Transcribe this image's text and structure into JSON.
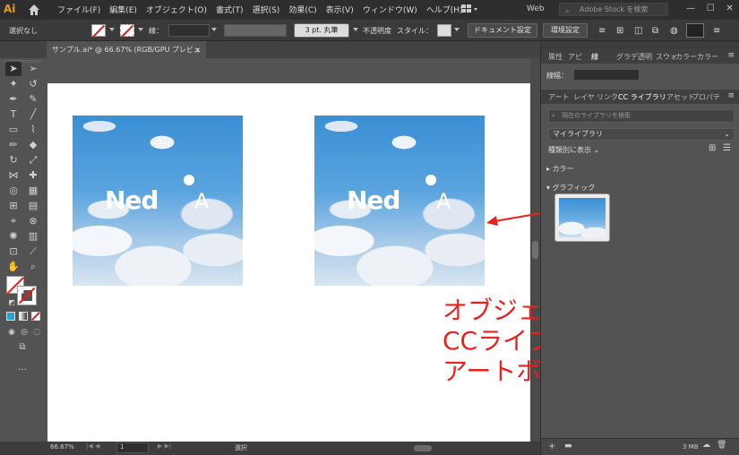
{
  "app": {
    "logo": "Ai"
  },
  "menubar": {
    "items": [
      "ファイル(F)",
      "編集(E)",
      "オブジェクト(O)",
      "書式(T)",
      "選択(S)",
      "効果(C)",
      "表示(V)",
      "ウィンドウ(W)",
      "ヘルプ(H)"
    ],
    "workspace": "Web",
    "stock_placeholder": "Adobe Stock を検索"
  },
  "control": {
    "selection": "選択なし",
    "stroke_label": "線：",
    "brush": "3 pt. 丸筆",
    "opacity_label": "不透明度",
    "style_label": "スタイル：",
    "doc_settings": "ドキュメント設定",
    "env_settings": "環境設定"
  },
  "document": {
    "tab_title": "サンプル.ai* @ 66.67% (RGB/GPU プレビュー)",
    "close": "×"
  },
  "canvas": {
    "logo_word": "Ned",
    "logo_tail": "A",
    "caption_lines": [
      "オブジェクトを",
      "CCライブラリから",
      "アートボードに配置"
    ]
  },
  "status": {
    "zoom": "66.67%",
    "page": "1",
    "mode": "選択"
  },
  "panels": {
    "top_tabs": [
      "属性",
      "アピ",
      "線",
      "グラデ",
      "透明",
      "スウォ",
      "カラー",
      "カラー"
    ],
    "stroke_label": "線幅：",
    "lib_tabs": [
      "アート",
      "レイヤ",
      "リンク",
      "CC ライブラリ",
      "アセット",
      "プロパテ"
    ],
    "search_placeholder": "現在のライブラリを検索",
    "library": "マイライブラリ",
    "sort": "種類別に表示",
    "section_color": "カラー",
    "section_graphic": "グラフィック",
    "footer_size": "3 MB"
  }
}
